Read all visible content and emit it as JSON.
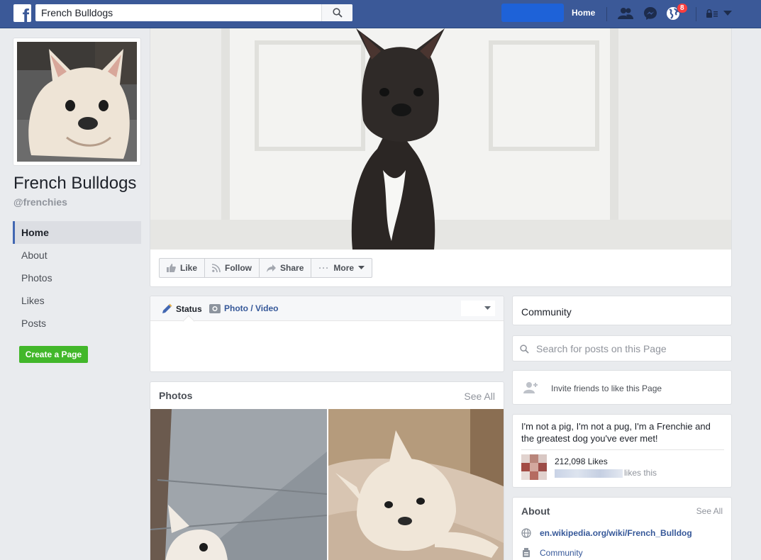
{
  "topbar": {
    "search_value": "French Bulldogs",
    "search_placeholder": "Search",
    "home_label": "Home",
    "notification_count": "8"
  },
  "page": {
    "name": "French Bulldogs",
    "handle": "@frenchies"
  },
  "sidebar": {
    "items": [
      {
        "label": "Home"
      },
      {
        "label": "About"
      },
      {
        "label": "Photos"
      },
      {
        "label": "Likes"
      },
      {
        "label": "Posts"
      }
    ],
    "create_page_label": "Create a Page"
  },
  "actions": {
    "like": "Like",
    "follow": "Follow",
    "share": "Share",
    "more": "More"
  },
  "composer": {
    "status_label": "Status",
    "photo_label": "Photo / Video"
  },
  "photos": {
    "title": "Photos",
    "see_all": "See All"
  },
  "right": {
    "community_label": "Community",
    "search_placeholder": "Search for posts on this Page",
    "invite_label": "Invite friends to like this Page",
    "blurb": "I'm not a pig, I'm not a pug, I'm a Frenchie and the greatest dog you've ever met!",
    "likes_count": "212,098 Likes",
    "likes_this": "likes this",
    "about_title": "About",
    "about_see_all": "See All",
    "wiki_link": "en.wikipedia.org/wiki/French_Bulldog",
    "category": "Community"
  },
  "colors": {
    "brand": "#3b5998",
    "create_green": "#42b72a",
    "link": "#365899",
    "badge": "#fa3e3e"
  }
}
